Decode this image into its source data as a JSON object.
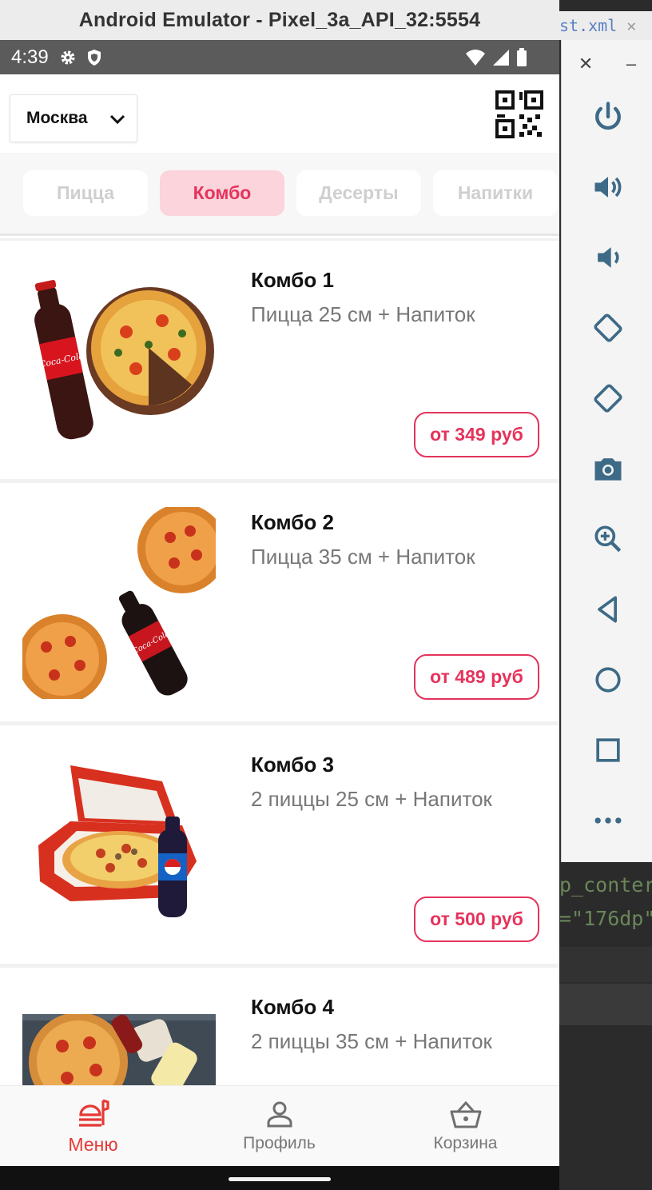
{
  "window": {
    "title": "Android Emulator - Pixel_3a_API_32:5554"
  },
  "ide": {
    "tab_label": "st.xml",
    "tab_close": "✕",
    "code_line1": "p_conter",
    "code_line2": "=\"176dp\""
  },
  "emulator_toolbar": {
    "close": "✕",
    "minimize": "–",
    "tools": [
      "power-icon",
      "volume-up-icon",
      "volume-down-icon",
      "rotate-left-icon",
      "rotate-right-icon",
      "camera-icon",
      "zoom-icon",
      "back-icon",
      "home-icon",
      "overview-icon",
      "more-icon"
    ]
  },
  "status_bar": {
    "time": "4:39"
  },
  "header": {
    "city": "Москва"
  },
  "tabs": [
    {
      "label": "Пицца",
      "active": false
    },
    {
      "label": "Комбо",
      "active": true
    },
    {
      "label": "Десерты",
      "active": false
    },
    {
      "label": "Напитки",
      "active": false
    }
  ],
  "products": [
    {
      "name": "Комбо 1",
      "desc": "Пицца 25 см + Напиток",
      "price": "от 349 руб"
    },
    {
      "name": "Комбо 2",
      "desc": "Пицца 35 см + Напиток",
      "price": "от 489 руб"
    },
    {
      "name": "Комбо 3",
      "desc": "2 пиццы 25 см + Напиток",
      "price": "от 500 руб"
    },
    {
      "name": "Комбо 4",
      "desc": "2 пиццы 35 см + Напиток",
      "price": ""
    }
  ],
  "bottom_nav": [
    {
      "label": "Меню",
      "active": true
    },
    {
      "label": "Профиль",
      "active": false
    },
    {
      "label": "Корзина",
      "active": false
    }
  ],
  "colors": {
    "accent": "#e5335c",
    "nav_active": "#e53935",
    "tab_active_bg": "#fbd4dc"
  }
}
